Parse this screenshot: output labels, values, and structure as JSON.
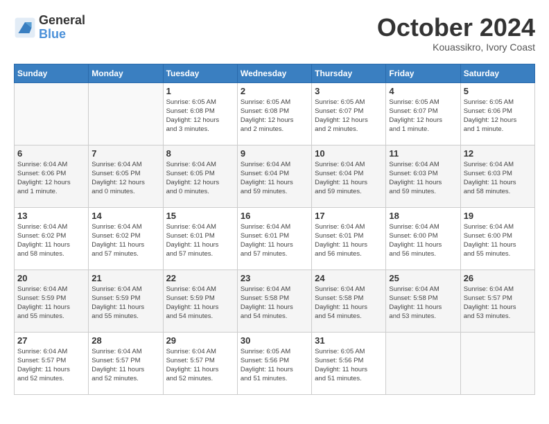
{
  "logo": {
    "general": "General",
    "blue": "Blue"
  },
  "title": "October 2024",
  "location": "Kouassikro, Ivory Coast",
  "days_of_week": [
    "Sunday",
    "Monday",
    "Tuesday",
    "Wednesday",
    "Thursday",
    "Friday",
    "Saturday"
  ],
  "weeks": [
    [
      {
        "day": "",
        "info": ""
      },
      {
        "day": "",
        "info": ""
      },
      {
        "day": "1",
        "info": "Sunrise: 6:05 AM\nSunset: 6:08 PM\nDaylight: 12 hours\nand 3 minutes."
      },
      {
        "day": "2",
        "info": "Sunrise: 6:05 AM\nSunset: 6:08 PM\nDaylight: 12 hours\nand 2 minutes."
      },
      {
        "day": "3",
        "info": "Sunrise: 6:05 AM\nSunset: 6:07 PM\nDaylight: 12 hours\nand 2 minutes."
      },
      {
        "day": "4",
        "info": "Sunrise: 6:05 AM\nSunset: 6:07 PM\nDaylight: 12 hours\nand 1 minute."
      },
      {
        "day": "5",
        "info": "Sunrise: 6:05 AM\nSunset: 6:06 PM\nDaylight: 12 hours\nand 1 minute."
      }
    ],
    [
      {
        "day": "6",
        "info": "Sunrise: 6:04 AM\nSunset: 6:06 PM\nDaylight: 12 hours\nand 1 minute."
      },
      {
        "day": "7",
        "info": "Sunrise: 6:04 AM\nSunset: 6:05 PM\nDaylight: 12 hours\nand 0 minutes."
      },
      {
        "day": "8",
        "info": "Sunrise: 6:04 AM\nSunset: 6:05 PM\nDaylight: 12 hours\nand 0 minutes."
      },
      {
        "day": "9",
        "info": "Sunrise: 6:04 AM\nSunset: 6:04 PM\nDaylight: 11 hours\nand 59 minutes."
      },
      {
        "day": "10",
        "info": "Sunrise: 6:04 AM\nSunset: 6:04 PM\nDaylight: 11 hours\nand 59 minutes."
      },
      {
        "day": "11",
        "info": "Sunrise: 6:04 AM\nSunset: 6:03 PM\nDaylight: 11 hours\nand 59 minutes."
      },
      {
        "day": "12",
        "info": "Sunrise: 6:04 AM\nSunset: 6:03 PM\nDaylight: 11 hours\nand 58 minutes."
      }
    ],
    [
      {
        "day": "13",
        "info": "Sunrise: 6:04 AM\nSunset: 6:02 PM\nDaylight: 11 hours\nand 58 minutes."
      },
      {
        "day": "14",
        "info": "Sunrise: 6:04 AM\nSunset: 6:02 PM\nDaylight: 11 hours\nand 57 minutes."
      },
      {
        "day": "15",
        "info": "Sunrise: 6:04 AM\nSunset: 6:01 PM\nDaylight: 11 hours\nand 57 minutes."
      },
      {
        "day": "16",
        "info": "Sunrise: 6:04 AM\nSunset: 6:01 PM\nDaylight: 11 hours\nand 57 minutes."
      },
      {
        "day": "17",
        "info": "Sunrise: 6:04 AM\nSunset: 6:01 PM\nDaylight: 11 hours\nand 56 minutes."
      },
      {
        "day": "18",
        "info": "Sunrise: 6:04 AM\nSunset: 6:00 PM\nDaylight: 11 hours\nand 56 minutes."
      },
      {
        "day": "19",
        "info": "Sunrise: 6:04 AM\nSunset: 6:00 PM\nDaylight: 11 hours\nand 55 minutes."
      }
    ],
    [
      {
        "day": "20",
        "info": "Sunrise: 6:04 AM\nSunset: 5:59 PM\nDaylight: 11 hours\nand 55 minutes."
      },
      {
        "day": "21",
        "info": "Sunrise: 6:04 AM\nSunset: 5:59 PM\nDaylight: 11 hours\nand 55 minutes."
      },
      {
        "day": "22",
        "info": "Sunrise: 6:04 AM\nSunset: 5:59 PM\nDaylight: 11 hours\nand 54 minutes."
      },
      {
        "day": "23",
        "info": "Sunrise: 6:04 AM\nSunset: 5:58 PM\nDaylight: 11 hours\nand 54 minutes."
      },
      {
        "day": "24",
        "info": "Sunrise: 6:04 AM\nSunset: 5:58 PM\nDaylight: 11 hours\nand 54 minutes."
      },
      {
        "day": "25",
        "info": "Sunrise: 6:04 AM\nSunset: 5:58 PM\nDaylight: 11 hours\nand 53 minutes."
      },
      {
        "day": "26",
        "info": "Sunrise: 6:04 AM\nSunset: 5:57 PM\nDaylight: 11 hours\nand 53 minutes."
      }
    ],
    [
      {
        "day": "27",
        "info": "Sunrise: 6:04 AM\nSunset: 5:57 PM\nDaylight: 11 hours\nand 52 minutes."
      },
      {
        "day": "28",
        "info": "Sunrise: 6:04 AM\nSunset: 5:57 PM\nDaylight: 11 hours\nand 52 minutes."
      },
      {
        "day": "29",
        "info": "Sunrise: 6:04 AM\nSunset: 5:57 PM\nDaylight: 11 hours\nand 52 minutes."
      },
      {
        "day": "30",
        "info": "Sunrise: 6:05 AM\nSunset: 5:56 PM\nDaylight: 11 hours\nand 51 minutes."
      },
      {
        "day": "31",
        "info": "Sunrise: 6:05 AM\nSunset: 5:56 PM\nDaylight: 11 hours\nand 51 minutes."
      },
      {
        "day": "",
        "info": ""
      },
      {
        "day": "",
        "info": ""
      }
    ]
  ]
}
